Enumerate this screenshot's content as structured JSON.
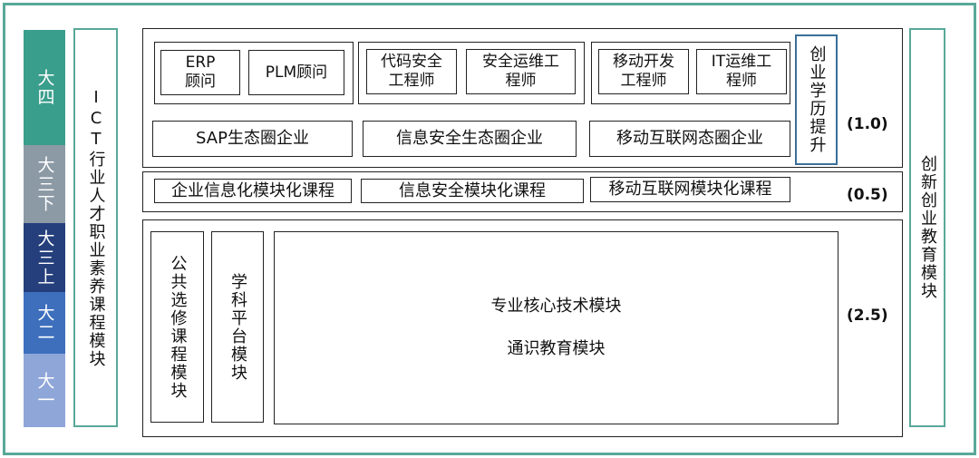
{
  "years": [
    {
      "label": "大四",
      "color": "#3a9e8c"
    },
    {
      "label": "大三下",
      "color": "#8c9aa6"
    },
    {
      "label": "大三上",
      "color": "#243f7c"
    },
    {
      "label": "大二",
      "color": "#3d6fbd"
    },
    {
      "label": "大一",
      "color": "#8fa6d9"
    }
  ],
  "left_module": "ICT行业人才职业素养课程模块",
  "right_module": "创新创业教育模块",
  "top": {
    "weight": "(1.0)",
    "groups": [
      {
        "items": [
          "ERP\n顾问",
          "PLM顾问"
        ],
        "eco": "SAP生态圈企业"
      },
      {
        "items": [
          "代码安全\n工程师",
          "安全运维工\n程师"
        ],
        "eco": "信息安全生态圈企业"
      },
      {
        "items": [
          "移动开发\n工程师",
          "IT运维工\n程师"
        ],
        "eco": "移动互联网态圈企业"
      }
    ],
    "entrepreneur": "创业学历提升"
  },
  "middle": {
    "weight": "(0.5)",
    "courses": [
      "企业信息化模块化课程",
      "信息安全模块化课程",
      "移动互联网模块化课程"
    ]
  },
  "bottom": {
    "weight": "(2.5)",
    "public_elective": "公共选修课程模块",
    "discipline_platform": "学科平台模块",
    "core": "专业核心技术模块",
    "general": "通识教育模块"
  }
}
